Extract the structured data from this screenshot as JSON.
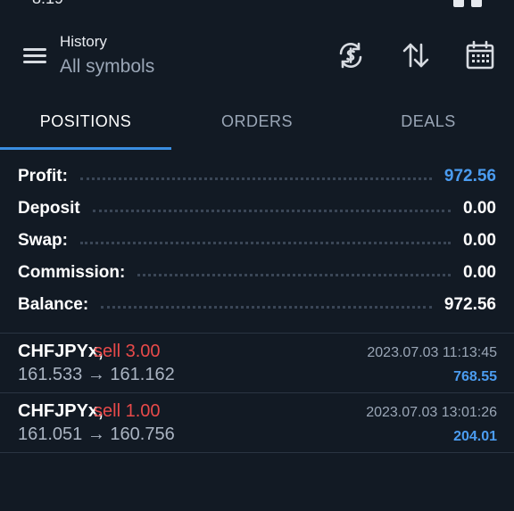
{
  "header": {
    "title": "History",
    "subtitle": "All symbols",
    "icons": [
      "menu-icon",
      "currency-sync-icon",
      "sort-icon",
      "calendar-icon"
    ]
  },
  "tabs": [
    {
      "label": "POSITIONS",
      "active": true
    },
    {
      "label": "ORDERS",
      "active": false
    },
    {
      "label": "DEALS",
      "active": false
    }
  ],
  "summary": [
    {
      "label": "Profit:",
      "value": "972.56",
      "highlight": true
    },
    {
      "label": "Deposit",
      "value": "0.00",
      "highlight": false
    },
    {
      "label": "Swap:",
      "value": "0.00",
      "highlight": false
    },
    {
      "label": "Commission:",
      "value": "0.00",
      "highlight": false
    },
    {
      "label": "Balance:",
      "value": "972.56",
      "highlight": false
    }
  ],
  "positions": [
    {
      "symbol": "CHFJPYx,",
      "side": "sell 3.00",
      "open_price": "161.533",
      "arrow": "→",
      "close_price": "161.162",
      "time": "2023.07.03 11:13:45",
      "profit": "768.55"
    },
    {
      "symbol": "CHFJPYx,",
      "side": "sell 1.00",
      "open_price": "161.051",
      "arrow": "→",
      "close_price": "160.756",
      "time": "2023.07.03 13:01:26",
      "profit": "204.01"
    }
  ],
  "colors": {
    "background": "#121a24",
    "accent": "#3a8de0",
    "profit_blue": "#4b9cf0",
    "sell_red": "#e84a4a"
  }
}
